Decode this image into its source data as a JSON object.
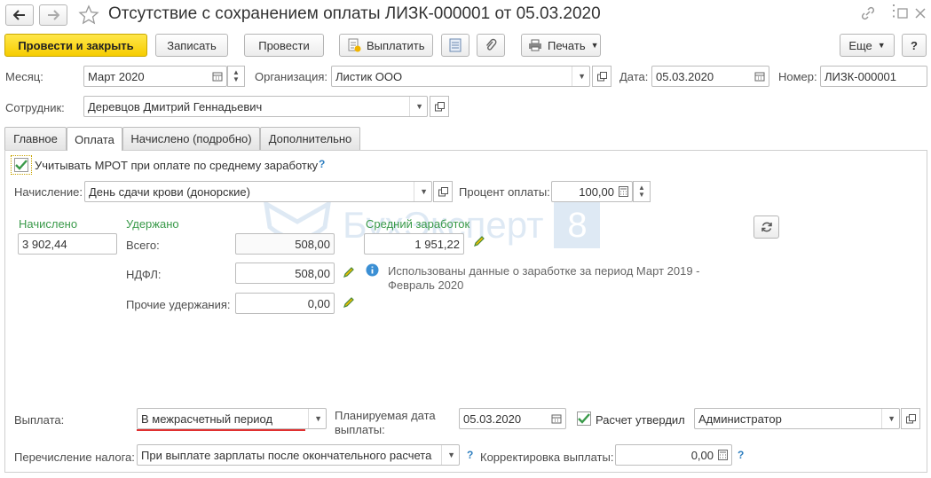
{
  "window": {
    "title": "Отсутствие с сохранением оплаты ЛИЗК-000001 от 05.03.2020"
  },
  "toolbar": {
    "post_close": "Провести и закрыть",
    "save": "Записать",
    "post": "Провести",
    "pay": "Выплатить",
    "print": "Печать",
    "more": "Еще",
    "help": "?"
  },
  "header": {
    "month_label": "Месяц:",
    "month_value": "Март 2020",
    "org_label": "Организация:",
    "org_value": "Листик ООО",
    "date_label": "Дата:",
    "date_value": "05.03.2020",
    "number_label": "Номер:",
    "number_value": "ЛИЗК-000001",
    "employee_label": "Сотрудник:",
    "employee_value": "Деревцов Дмитрий Геннадьевич"
  },
  "tabs": [
    {
      "label": "Главное"
    },
    {
      "label": "Оплата"
    },
    {
      "label": "Начислено (подробно)"
    },
    {
      "label": "Дополнительно"
    }
  ],
  "payment": {
    "mrot_label": "Учитывать МРОТ при оплате по среднему заработку",
    "mrot_checked": true,
    "accrual_label": "Начисление:",
    "accrual_value": "День сдачи крови (донорские)",
    "percent_label": "Процент оплаты:",
    "percent_value": "100,00",
    "accrued_header": "Начислено",
    "accrued_value": "3 902,44",
    "withheld_header": "Удержано",
    "total_label": "Всего:",
    "total_value": "508,00",
    "ndfl_label": "НДФЛ:",
    "ndfl_value": "508,00",
    "other_label": "Прочие удержания:",
    "other_value": "0,00",
    "avg_header": "Средний заработок",
    "avg_value": "1 951,22",
    "info_text": "Использованы данные о заработке за период Март 2019 - Февраль 2020"
  },
  "footer": {
    "payout_label": "Выплата:",
    "payout_value": "В межрасчетный период",
    "planned_label": "Планируемая дата выплаты:",
    "planned_value": "05.03.2020",
    "approved_label": "Расчет утвердил",
    "approved_checked": true,
    "approver_value": "Администратор",
    "tax_label": "Перечисление налога:",
    "tax_value": "При выплате зарплаты после окончательного расчета",
    "correction_label": "Корректировка выплаты:",
    "correction_value": "0,00"
  },
  "watermark": {
    "text": "БухЭксперт",
    "badge": "8"
  },
  "colors": {
    "primary_button": "#f6cc00",
    "green_header": "#3a9a4a",
    "help_blue": "#2f7fc0",
    "underline_red": "#e03030"
  }
}
